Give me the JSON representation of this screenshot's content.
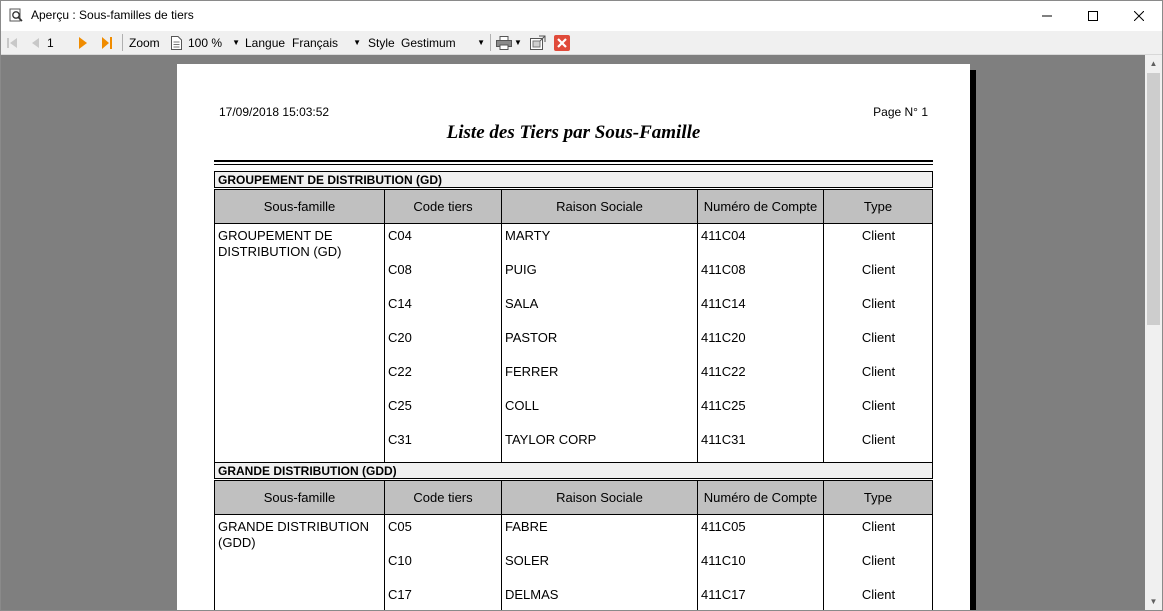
{
  "window": {
    "title": "Aperçu : Sous-familles de tiers"
  },
  "toolbar": {
    "page_number": "1",
    "zoom_label": "Zoom",
    "zoom_value": "100 %",
    "langue_label": "Langue",
    "langue_value": "Français",
    "style_label": "Style",
    "style_value": "Gestimum"
  },
  "report": {
    "date": "17/09/2018 15:03:52",
    "page": "Page N° 1",
    "title": "Liste des Tiers par Sous-Famille",
    "columns": [
      "Sous-famille",
      "Code tiers",
      "Raison Sociale",
      "Numéro de Compte",
      "Type"
    ],
    "groups": [
      {
        "title": "GROUPEMENT DE DISTRIBUTION (GD)",
        "sous_famille": "GROUPEMENT DE DISTRIBUTION (GD)",
        "rows": [
          {
            "code": "C04",
            "raison": "MARTY",
            "compte": "411C04",
            "type": "Client"
          },
          {
            "code": "C08",
            "raison": "PUIG",
            "compte": "411C08",
            "type": "Client"
          },
          {
            "code": "C14",
            "raison": "SALA",
            "compte": "411C14",
            "type": "Client"
          },
          {
            "code": "C20",
            "raison": "PASTOR",
            "compte": "411C20",
            "type": "Client"
          },
          {
            "code": "C22",
            "raison": "FERRER",
            "compte": "411C22",
            "type": "Client"
          },
          {
            "code": "C25",
            "raison": "COLL",
            "compte": "411C25",
            "type": "Client"
          },
          {
            "code": "C31",
            "raison": "TAYLOR CORP",
            "compte": "411C31",
            "type": "Client"
          }
        ]
      },
      {
        "title": "GRANDE DISTRIBUTION (GDD)",
        "sous_famille": "GRANDE DISTRIBUTION (GDD)",
        "rows": [
          {
            "code": "C05",
            "raison": "FABRE",
            "compte": "411C05",
            "type": "Client"
          },
          {
            "code": "C10",
            "raison": "SOLER",
            "compte": "411C10",
            "type": "Client"
          },
          {
            "code": "C17",
            "raison": "DELMAS",
            "compte": "411C17",
            "type": "Client"
          }
        ]
      }
    ]
  }
}
